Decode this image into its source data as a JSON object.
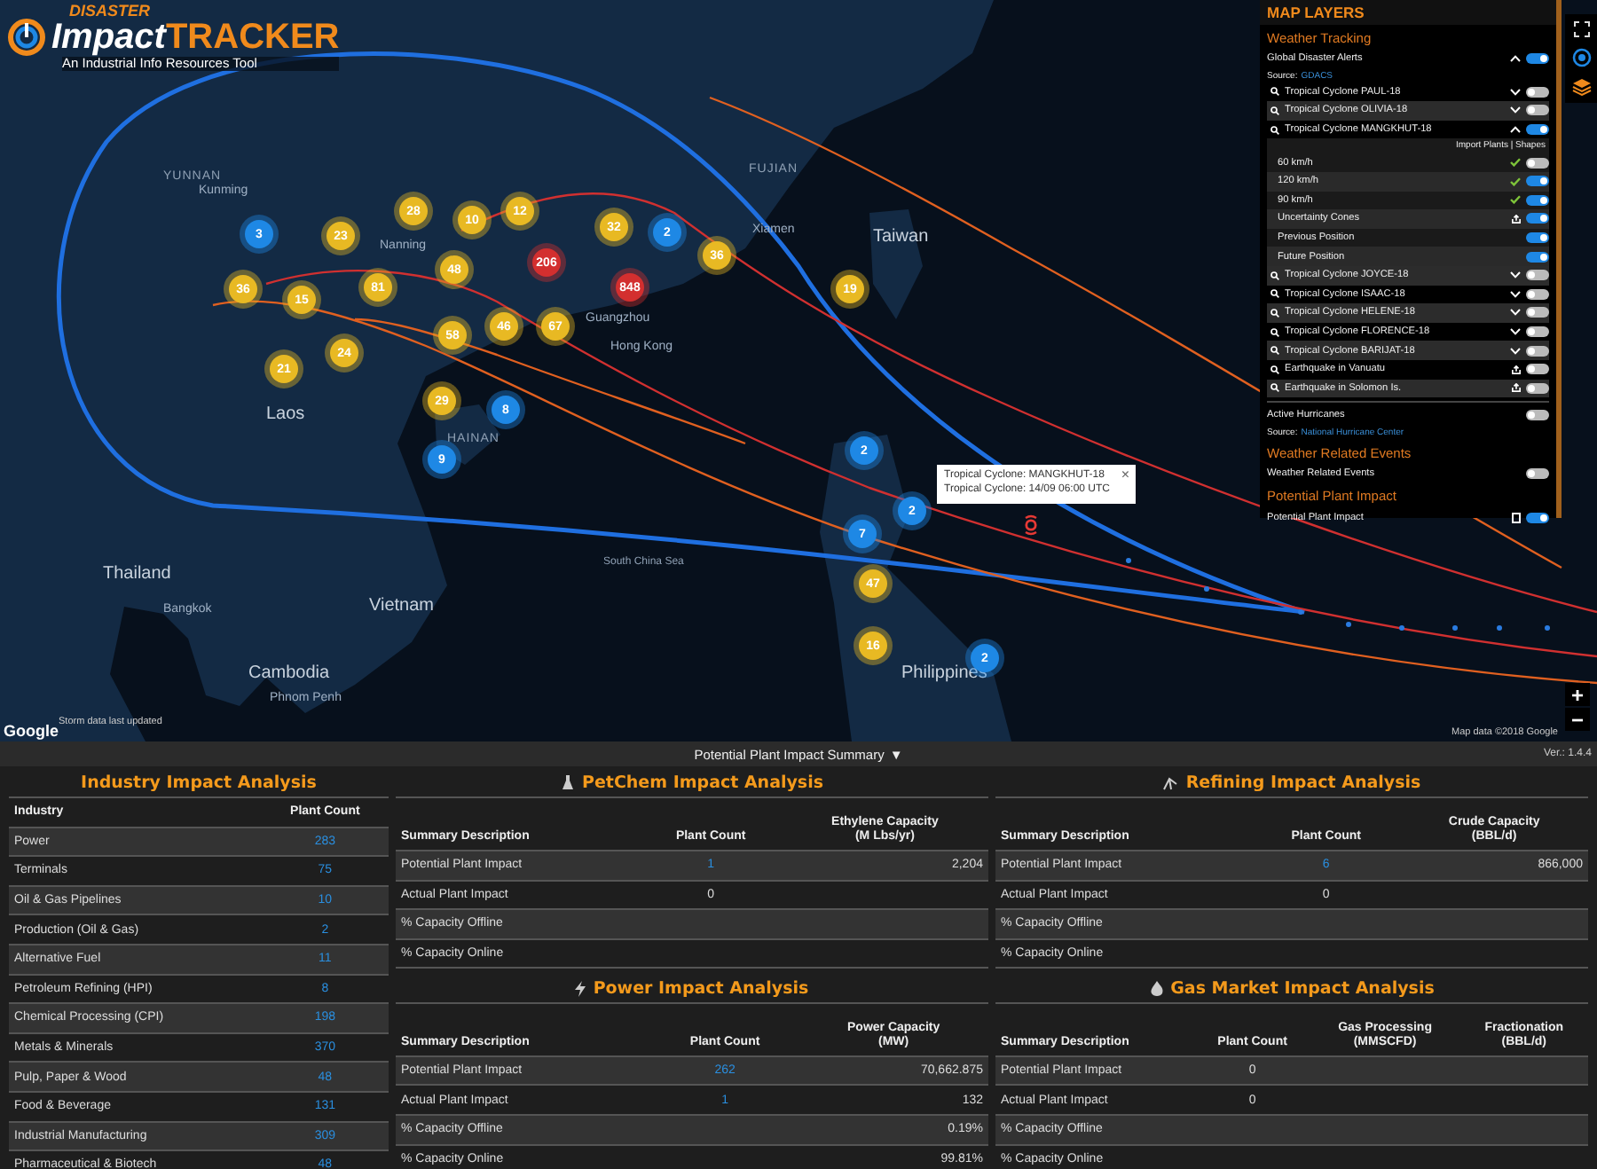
{
  "logo": {
    "top": "DISASTER",
    "main": "Impact",
    "accent": "TRACKER",
    "tagline": "An Industrial Info Resources Tool"
  },
  "map": {
    "labels": [
      "YUNNAN",
      "Kunming",
      "FUJIAN",
      "Xiamen",
      "Taiwan",
      "Nanning",
      "Guangzhou",
      "Hong Kong",
      "HAINAN",
      "Laos",
      "Thailand",
      "Bangkok",
      "Vietnam",
      "Cambodia",
      "Phnom Penh",
      "South China Sea",
      "Philippines"
    ],
    "clusters": [
      {
        "count": "3",
        "color": "#1e88e5"
      },
      {
        "count": "23",
        "color": "#e8b923"
      },
      {
        "count": "28",
        "color": "#e8b923"
      },
      {
        "count": "10",
        "color": "#e8b923"
      },
      {
        "count": "12",
        "color": "#e8b923"
      },
      {
        "count": "32",
        "color": "#e8b923"
      },
      {
        "count": "2",
        "color": "#1e88e5"
      },
      {
        "count": "36",
        "color": "#e8b923"
      },
      {
        "count": "206",
        "color": "#d32f2f"
      },
      {
        "count": "848",
        "color": "#d32f2f"
      },
      {
        "count": "48",
        "color": "#e8b923"
      },
      {
        "count": "81",
        "color": "#e8b923"
      },
      {
        "count": "15",
        "color": "#e8b923"
      },
      {
        "count": "36",
        "color": "#e8b923"
      },
      {
        "count": "58",
        "color": "#e8b923"
      },
      {
        "count": "46",
        "color": "#e8b923"
      },
      {
        "count": "67",
        "color": "#e8b923"
      },
      {
        "count": "24",
        "color": "#e8b923"
      },
      {
        "count": "21",
        "color": "#e8b923"
      },
      {
        "count": "29",
        "color": "#e8b923"
      },
      {
        "count": "8",
        "color": "#1e88e5"
      },
      {
        "count": "9",
        "color": "#1e88e5"
      },
      {
        "count": "19",
        "color": "#e8b923"
      },
      {
        "count": "2",
        "color": "#1e88e5"
      },
      {
        "count": "2",
        "color": "#1e88e5"
      },
      {
        "count": "7",
        "color": "#1e88e5"
      },
      {
        "count": "47",
        "color": "#e8b923"
      },
      {
        "count": "16",
        "color": "#e8b923"
      },
      {
        "count": "2",
        "color": "#1e88e5"
      }
    ],
    "popup": {
      "lines": [
        "Tropical Cyclone: MANGKHUT-18",
        "Tropical Cyclone: 14/09 06:00 UTC"
      ],
      "close": "×"
    },
    "storm_note": "Storm data last updated",
    "google": "Google",
    "attribution": "Map data ©2018 Google",
    "zoom_in": "+",
    "zoom_out": "−"
  },
  "map_layers": {
    "title": "MAP LAYERS",
    "sections": [
      {
        "title": "Weather Tracking",
        "items": [
          {
            "kind": "source",
            "label": "Global Disaster Alerts",
            "source_label": "Source:",
            "source": "GDACS",
            "caret": true,
            "expanded": true,
            "on": true,
            "children": [
              {
                "kind": "event",
                "label": "Tropical Cyclone PAUL-18",
                "expanded": false,
                "on": false
              },
              {
                "kind": "event",
                "label": "Tropical Cyclone OLIVIA-18",
                "expanded": false,
                "on": false
              },
              {
                "kind": "event",
                "label": "Tropical Cyclone MANGKHUT-18",
                "expanded": true,
                "on": true,
                "links": "Import Plants | Shapes",
                "children": [
                  {
                    "kind": "speed",
                    "label": "60 km/h",
                    "checked": true,
                    "on": false
                  },
                  {
                    "kind": "speed",
                    "label": "120 km/h",
                    "checked": true,
                    "on": true
                  },
                  {
                    "kind": "speed",
                    "label": "90 km/h",
                    "checked": true,
                    "on": true
                  },
                  {
                    "kind": "export",
                    "label": "Uncertainty Cones",
                    "on": true
                  },
                  {
                    "kind": "plain",
                    "label": "Previous Position",
                    "on": true
                  },
                  {
                    "kind": "plain",
                    "label": "Future Position",
                    "on": true
                  }
                ]
              },
              {
                "kind": "event",
                "label": "Tropical Cyclone JOYCE-18",
                "expanded": false,
                "on": false
              },
              {
                "kind": "event",
                "label": "Tropical Cyclone ISAAC-18",
                "expanded": false,
                "on": false
              },
              {
                "kind": "event",
                "label": "Tropical Cyclone HELENE-18",
                "expanded": false,
                "on": false
              },
              {
                "kind": "event",
                "label": "Tropical Cyclone FLORENCE-18",
                "expanded": false,
                "on": false
              },
              {
                "kind": "event",
                "label": "Tropical Cyclone BARIJAT-18",
                "expanded": false,
                "on": false
              },
              {
                "kind": "quake",
                "label": "Earthquake in Vanuatu",
                "on": false
              },
              {
                "kind": "quake",
                "label": "Earthquake in Solomon Is.",
                "on": false
              }
            ]
          },
          {
            "kind": "source",
            "label": "Active Hurricanes",
            "source_label": "Source:",
            "source": "National Hurricane Center",
            "caret": false,
            "on": false
          }
        ]
      },
      {
        "title": "Weather Related Events",
        "items": [
          {
            "kind": "plain",
            "label": "Weather Related Events",
            "on": false
          }
        ]
      },
      {
        "title": "Potential Plant Impact",
        "items": [
          {
            "kind": "box",
            "label": "Potential Plant Impact",
            "checked": false,
            "on": true
          }
        ]
      }
    ]
  },
  "summary_bar": {
    "title": "Potential Plant Impact Summary",
    "caret": "▼",
    "version": "Ver.: 1.4.4"
  },
  "industry": {
    "title": "Industry Impact Analysis",
    "columns": [
      "Industry",
      "Plant Count"
    ],
    "rows": [
      [
        "Power",
        "283"
      ],
      [
        "Terminals",
        "75"
      ],
      [
        "Oil & Gas Pipelines",
        "10"
      ],
      [
        "Production (Oil & Gas)",
        "2"
      ],
      [
        "Alternative Fuel",
        "11"
      ],
      [
        "Petroleum Refining (HPI)",
        "8"
      ],
      [
        "Chemical Processing (CPI)",
        "198"
      ],
      [
        "Metals & Minerals",
        "370"
      ],
      [
        "Pulp, Paper & Wood",
        "48"
      ],
      [
        "Food & Beverage",
        "131"
      ],
      [
        "Industrial Manufacturing",
        "309"
      ],
      [
        "Pharmaceutical & Biotech",
        "48"
      ]
    ]
  },
  "analyses": [
    {
      "title": "PetChem Impact Analysis",
      "columns": [
        {
          "label": "Summary Description"
        },
        {
          "label": "Plant Count"
        },
        {
          "label": "Ethylene Capacity",
          "unit": "(M Lbs/yr)"
        }
      ],
      "rows": [
        {
          "cells": [
            "Potential Plant Impact",
            "1",
            "2,204"
          ],
          "count_link": true
        },
        {
          "cells": [
            "Actual Plant Impact",
            "0",
            ""
          ],
          "count_link": false
        },
        {
          "cells": [
            "% Capacity Offline",
            "",
            ""
          ]
        },
        {
          "cells": [
            "% Capacity Online",
            "",
            ""
          ]
        }
      ]
    },
    {
      "title": "Refining Impact Analysis",
      "columns": [
        {
          "label": "Summary Description"
        },
        {
          "label": "Plant Count"
        },
        {
          "label": "Crude Capacity",
          "unit": "(BBL/d)"
        }
      ],
      "rows": [
        {
          "cells": [
            "Potential Plant Impact",
            "6",
            "866,000"
          ],
          "count_link": true
        },
        {
          "cells": [
            "Actual Plant Impact",
            "0",
            ""
          ],
          "count_link": false
        },
        {
          "cells": [
            "% Capacity Offline",
            "",
            ""
          ]
        },
        {
          "cells": [
            "% Capacity Online",
            "",
            ""
          ]
        }
      ]
    },
    {
      "title": "Power Impact Analysis",
      "columns": [
        {
          "label": "Summary Description"
        },
        {
          "label": "Plant Count"
        },
        {
          "label": "Power Capacity",
          "unit": "(MW)"
        }
      ],
      "rows": [
        {
          "cells": [
            "Potential Plant Impact",
            "262",
            "70,662.875"
          ],
          "count_link": true
        },
        {
          "cells": [
            "Actual Plant Impact",
            "1",
            "132"
          ],
          "count_link": true
        },
        {
          "cells": [
            "% Capacity Offline",
            "",
            "0.19%"
          ]
        },
        {
          "cells": [
            "% Capacity Online",
            "",
            "99.81%"
          ]
        }
      ]
    },
    {
      "title": "Gas Market Impact Analysis",
      "columns": [
        {
          "label": "Summary Description"
        },
        {
          "label": "Plant Count"
        },
        {
          "label": "Gas Processing",
          "unit": "(MMSCFD)"
        },
        {
          "label": "Fractionation",
          "unit": "(BBL/d)"
        }
      ],
      "rows": [
        {
          "cells": [
            "Potential Plant Impact",
            "0",
            "",
            ""
          ],
          "count_link": false
        },
        {
          "cells": [
            "Actual Plant Impact",
            "0",
            "",
            ""
          ],
          "count_link": false
        },
        {
          "cells": [
            "% Capacity Offline",
            "",
            "",
            ""
          ]
        },
        {
          "cells": [
            "% Capacity Online",
            "",
            "",
            ""
          ]
        }
      ]
    }
  ]
}
